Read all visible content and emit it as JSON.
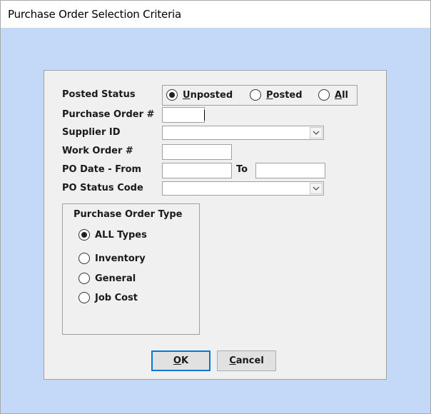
{
  "window": {
    "title": "Purchase Order Selection Criteria"
  },
  "posted_status": {
    "label": "Posted Status",
    "options": [
      {
        "pre": "",
        "key": "U",
        "post": "nposted",
        "checked": true
      },
      {
        "pre": "",
        "key": "P",
        "post": "osted",
        "checked": false
      },
      {
        "pre": "",
        "key": "A",
        "post": "ll",
        "checked": false
      }
    ]
  },
  "fields": {
    "purchase_order_label": "Purchase Order #",
    "purchase_order_value": "",
    "supplier_id_label": "Supplier ID",
    "supplier_id_value": "",
    "work_order_label": "Work Order #",
    "work_order_value": "",
    "po_date_from_label": "PO Date - From",
    "po_date_from_value": "",
    "po_date_to_label": "To",
    "po_date_to_value": "",
    "po_status_code_label": "PO Status Code",
    "po_status_code_value": ""
  },
  "order_type": {
    "title": "Purchase Order Type",
    "options": [
      {
        "label": "ALL Types",
        "checked": true
      },
      {
        "label": "Inventory",
        "checked": false
      },
      {
        "label": "General",
        "checked": false
      },
      {
        "label": "Job Cost",
        "checked": false
      }
    ]
  },
  "buttons": {
    "ok": {
      "key": "O",
      "rest": "K"
    },
    "cancel": {
      "key": "C",
      "rest": "ancel"
    }
  },
  "icons": {
    "dropdown": "chevron-down-icon",
    "radio": "radio-button-icon"
  }
}
